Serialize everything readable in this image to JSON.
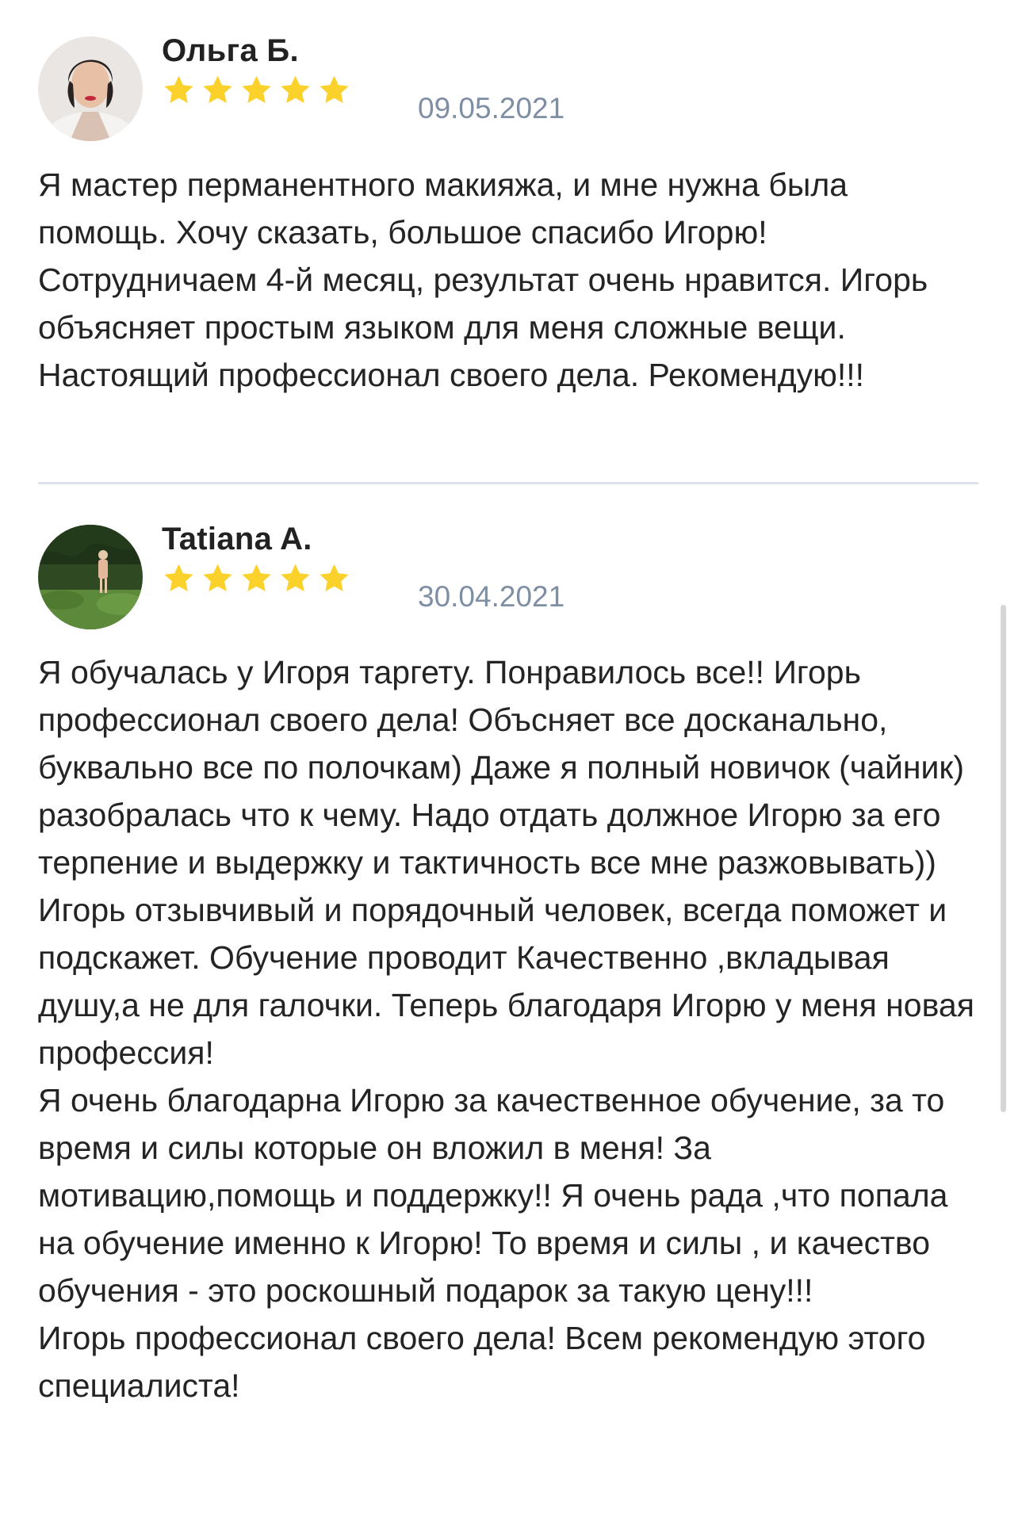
{
  "reviews": [
    {
      "author": "Ольга Б.",
      "rating": 5,
      "date": "09.05.2021",
      "avatar_icon": "user-photo-icon",
      "paragraphs": [
        "Я мастер перманентного макияжа, и мне нужна была помощь. Хочу сказать, большое спасибо Игорю! Сотрудничаем 4-й месяц, результат очень нравится. Игорь объясняет простым языком для меня сложные вещи. Настоящий профессионал своего дела. Рекомендую!!!"
      ]
    },
    {
      "author": "Tatiana A.",
      "rating": 5,
      "date": "30.04.2021",
      "avatar_icon": "user-photo-icon",
      "paragraphs": [
        "Я обучалась у Игоря таргету. Понравилось все!! Игорь профессионал своего дела! Объсняет все досканально, буквально все по полочкам) Даже я полный новичок (чайник) разобралась что к чему. Надо отдать должное Игорю за его терпение и выдержку и тактичность все мне разжовывать)) Игорь отзывчивый и порядочный человек, всегда поможет и подскажет. Обучение проводит Качественно ,вкладывая душу,а не для галочки. Теперь благодаря Игорю у меня новая профессия!",
        "Я очень благодарна Игорю за качественное обучение, за то время и силы которые он вложил в меня! За мотивацию,помощь и поддержку!! Я очень рада ,что попала на обучение именно к Игорю! То время и силы , и качество обучения - это роскошный подарок за такую цену!!!",
        "Игорь профессионал своего дела! Всем рекомендую этого специалиста!"
      ]
    }
  ],
  "colors": {
    "star": "#fbd22c",
    "date": "#7f8fa3",
    "divider": "#dde3ea",
    "text": "#242424"
  }
}
